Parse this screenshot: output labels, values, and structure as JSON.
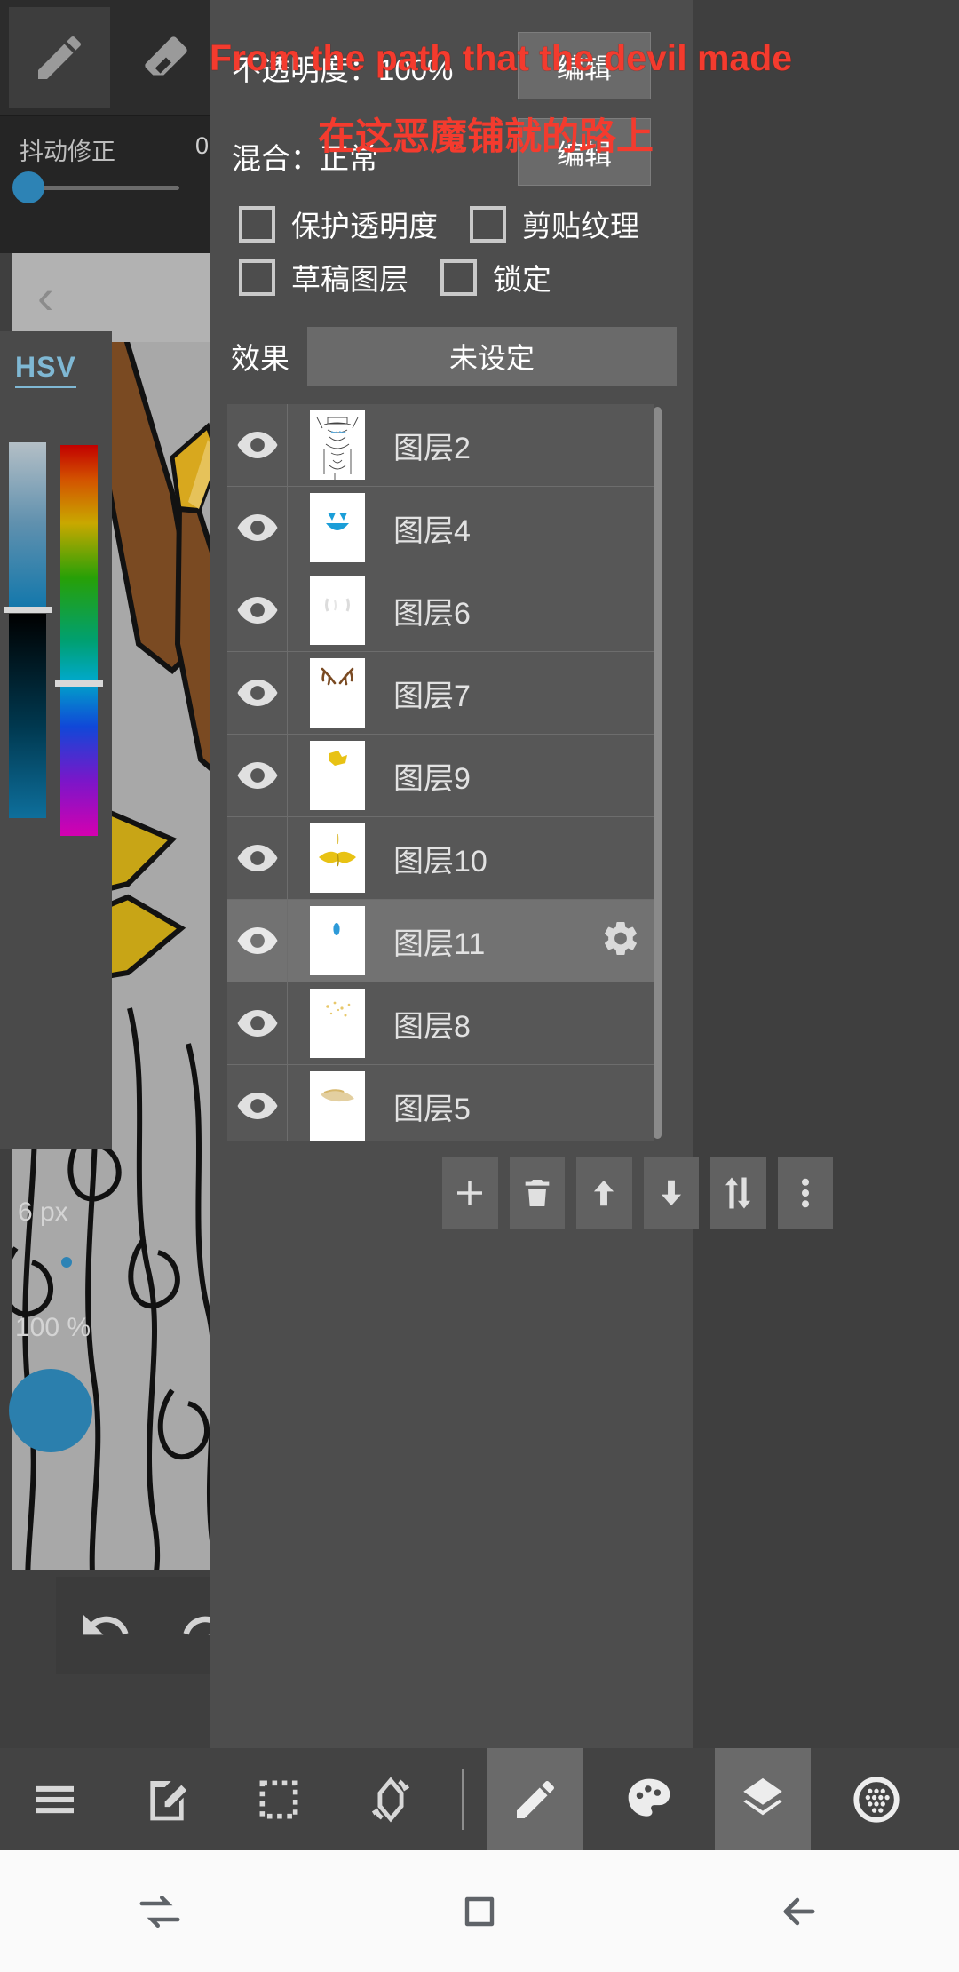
{
  "subtitle": {
    "english": "From the path that the devil made",
    "chinese": "在这恶魔铺就的路上",
    "color": "#f43b2e"
  },
  "tool_strip": {
    "tools": [
      {
        "name": "pencil-tool",
        "selected": true
      },
      {
        "name": "eraser-tool",
        "selected": false
      },
      {
        "name": "shape-tool",
        "selected": false
      }
    ],
    "stabilizer_label": "抖动修正",
    "stabilizer_value": "0",
    "lock_label": "锁定",
    "lock_state": "off"
  },
  "color_panel": {
    "mode_label": "HSV",
    "brush_size": "6 px",
    "opacity": "100 %",
    "current_color": "#2b7fad",
    "accent": "#7fb8d4"
  },
  "layer_properties": {
    "opacity_label": "不透明度：100%",
    "opacity_edit": "编辑",
    "blend_label": "混合：正常",
    "blend_edit": "编辑",
    "checkboxes": [
      {
        "label": "保护透明度",
        "checked": false
      },
      {
        "label": "剪贴纹理",
        "checked": false
      },
      {
        "label": "草稿图层",
        "checked": false
      },
      {
        "label": "锁定",
        "checked": false
      }
    ],
    "effect_label": "效果",
    "effect_value": "未设定"
  },
  "layers": [
    {
      "name": "图层2",
      "visible": true,
      "selected": false,
      "thumb": "sketch"
    },
    {
      "name": "图层4",
      "visible": true,
      "selected": false,
      "thumb": "face"
    },
    {
      "name": "图层6",
      "visible": true,
      "selected": false,
      "thumb": "white-marks"
    },
    {
      "name": "图层7",
      "visible": true,
      "selected": false,
      "thumb": "antlers"
    },
    {
      "name": "图层9",
      "visible": true,
      "selected": false,
      "thumb": "yellow-small"
    },
    {
      "name": "图层10",
      "visible": true,
      "selected": false,
      "thumb": "gold-wings"
    },
    {
      "name": "图层11",
      "visible": true,
      "selected": true,
      "thumb": "blue-dot"
    },
    {
      "name": "图层8",
      "visible": true,
      "selected": false,
      "thumb": "specks"
    },
    {
      "name": "图层5",
      "visible": true,
      "selected": false,
      "thumb": "tan-smear"
    }
  ],
  "layer_actions": [
    {
      "name": "add-layer-button",
      "icon": "plus-icon"
    },
    {
      "name": "delete-layer-button",
      "icon": "trash-icon"
    },
    {
      "name": "move-layer-up-button",
      "icon": "arrow-up-icon"
    },
    {
      "name": "move-layer-down-button",
      "icon": "arrow-down-icon"
    },
    {
      "name": "reorder-layers-button",
      "icon": "swap-vertical-icon"
    },
    {
      "name": "layer-more-button",
      "icon": "more-vertical-icon"
    }
  ],
  "app_toolbar": [
    {
      "name": "menu-button",
      "icon": "hamburger-icon",
      "selected": false
    },
    {
      "name": "edit-button",
      "icon": "edit-page-icon",
      "selected": false
    },
    {
      "name": "select-button",
      "icon": "marquee-icon",
      "selected": false
    },
    {
      "name": "transform-button",
      "icon": "rotate-icon",
      "selected": false
    },
    {
      "name": "brush-button",
      "icon": "pencil-icon",
      "selected": true
    },
    {
      "name": "palette-button",
      "icon": "palette-icon",
      "selected": false
    },
    {
      "name": "layers-button",
      "icon": "layers-icon",
      "selected": true
    },
    {
      "name": "material-button",
      "icon": "dotted-circle-icon",
      "selected": false
    }
  ],
  "history": [
    {
      "name": "undo-button",
      "icon": "undo-arrow-icon"
    },
    {
      "name": "redo-button",
      "icon": "redo-arrow-icon"
    }
  ],
  "nav_bar": [
    {
      "name": "recents-button",
      "icon": "recents-icon"
    },
    {
      "name": "home-button",
      "icon": "home-square-icon"
    },
    {
      "name": "back-button",
      "icon": "back-arrow-icon"
    }
  ]
}
